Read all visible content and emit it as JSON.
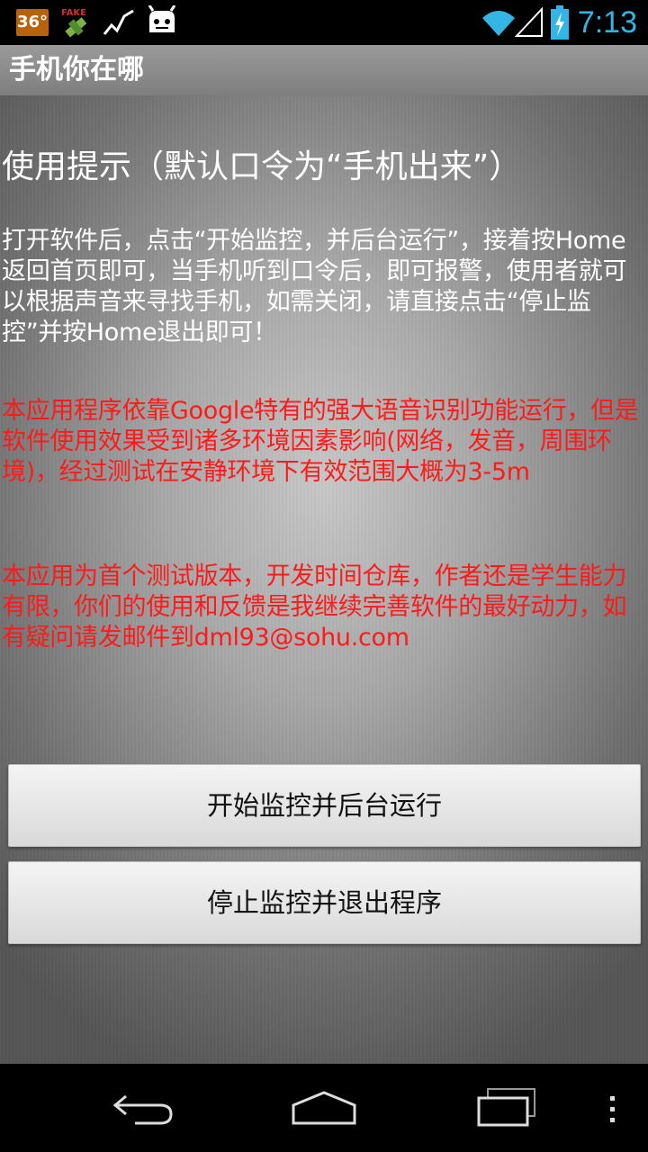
{
  "status_bar": {
    "temperature_badge": "36°",
    "fake_label": "FAKE",
    "time": "7:13",
    "icons": [
      "temperature-badge-icon",
      "fake-gps-icon",
      "activity-graph-icon",
      "android-bot-icon",
      "wifi-icon",
      "signal-icon",
      "battery-charging-icon"
    ],
    "accent_color": "#33b5e5"
  },
  "action_bar": {
    "title": "手机你在哪"
  },
  "content": {
    "heading": "使用提示（默认口令为“手机出来”）",
    "instructions": "打开软件后，点击“开始监控，并后台运行”，接着按Home返回首页即可，当手机听到口令后，即可报警，使用者就可以根据声音来寻找手机，如需关闭，请直接点击“停止监控”并按Home退出即可！",
    "warning_1": "本应用程序依靠Google特有的强大语音识别功能运行，但是软件使用效果受到诸多环境因素影响(网络，发音，周围环境)，经过测试在安静环境下有效范围大概为3-5m",
    "warning_2": "本应用为首个测试版本，开发时间仓库，作者还是学生能力有限，你们的使用和反馈是我继续完善软件的最好动力，如有疑问请发邮件到dml93@sohu.com",
    "warning_color": "#ff1a1a"
  },
  "buttons": {
    "start_label": "开始监控并后台运行",
    "stop_label": "停止监控并退出程序"
  },
  "nav_bar": {
    "icons": [
      "back-icon",
      "home-icon",
      "recent-apps-icon",
      "overflow-menu-icon"
    ]
  }
}
